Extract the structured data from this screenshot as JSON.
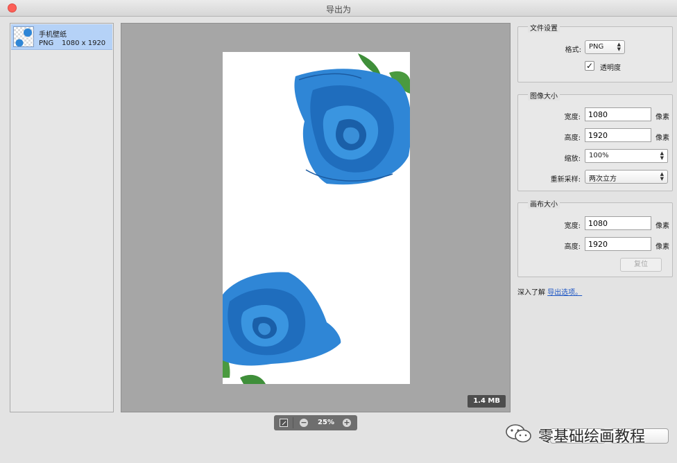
{
  "window": {
    "title": "导出为"
  },
  "assets": {
    "items": [
      {
        "name": "手机壁纸",
        "format": "PNG",
        "dimensions": "1080 x 1920"
      }
    ]
  },
  "preview": {
    "file_size": "1.4 MB",
    "zoom": "25%"
  },
  "file_settings": {
    "heading": "文件设置",
    "format_label": "格式:",
    "format_value": "PNG",
    "transparency_label": "透明度",
    "transparency_checked": true
  },
  "image_size": {
    "heading": "图像大小",
    "width_label": "宽度:",
    "width_value": "1080",
    "height_label": "高度:",
    "height_value": "1920",
    "scale_label": "缩放:",
    "scale_value": "100%",
    "resample_label": "重新采样:",
    "resample_value": "两次立方",
    "unit": "像素"
  },
  "canvas_size": {
    "heading": "画布大小",
    "width_label": "宽度:",
    "width_value": "1080",
    "height_label": "高度:",
    "height_value": "1920",
    "unit": "像素",
    "reset_label": "复位"
  },
  "learn_more": {
    "prefix": "深入了解",
    "link": "导出选项。"
  },
  "watermark": {
    "text": "零基础绘画教程"
  },
  "colors": {
    "selection": "#b5d2f7",
    "preview_bg": "#a6a6a6",
    "rose_blue": "#2f86d6",
    "link": "#1d56c4"
  }
}
